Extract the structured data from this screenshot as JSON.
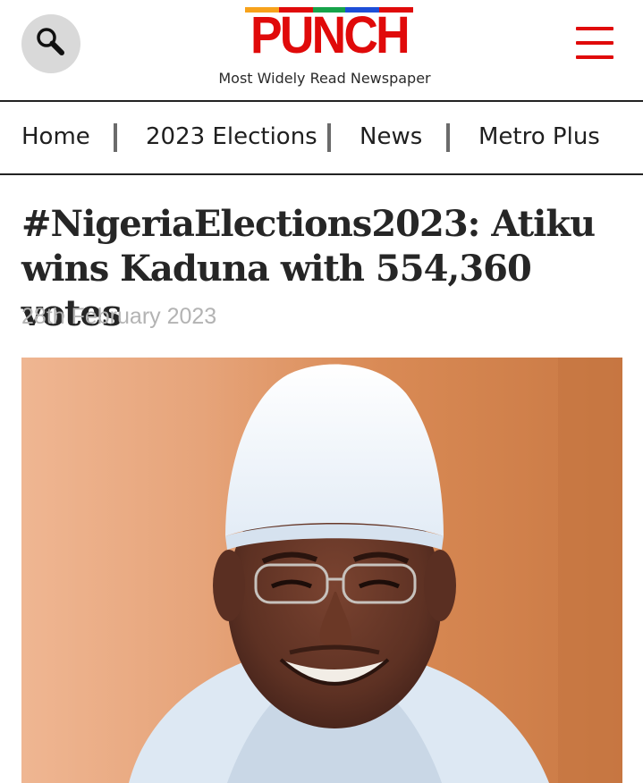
{
  "header": {
    "logo_text": "PUNCH",
    "tagline": "Most Widely Read Newspaper",
    "search_icon": "search-icon",
    "menu_icon": "hamburger-menu-icon",
    "logo_stripe_colors": [
      "#f7a21b",
      "#e00a0a",
      "#16a34a",
      "#1d4ed8",
      "#e00a0a"
    ]
  },
  "nav": {
    "items": [
      {
        "label": "Home"
      },
      {
        "label": "2023 Elections"
      },
      {
        "label": "News"
      },
      {
        "label": "Metro Plus"
      }
    ]
  },
  "article": {
    "title": "#NigeriaElections2023: Atiku wins Kaduna with 554,360 votes",
    "date": "28th February 2023"
  },
  "colors": {
    "brand_red": "#e00a0a",
    "text_dark": "#262626",
    "date_gray": "#b3b3b3"
  }
}
